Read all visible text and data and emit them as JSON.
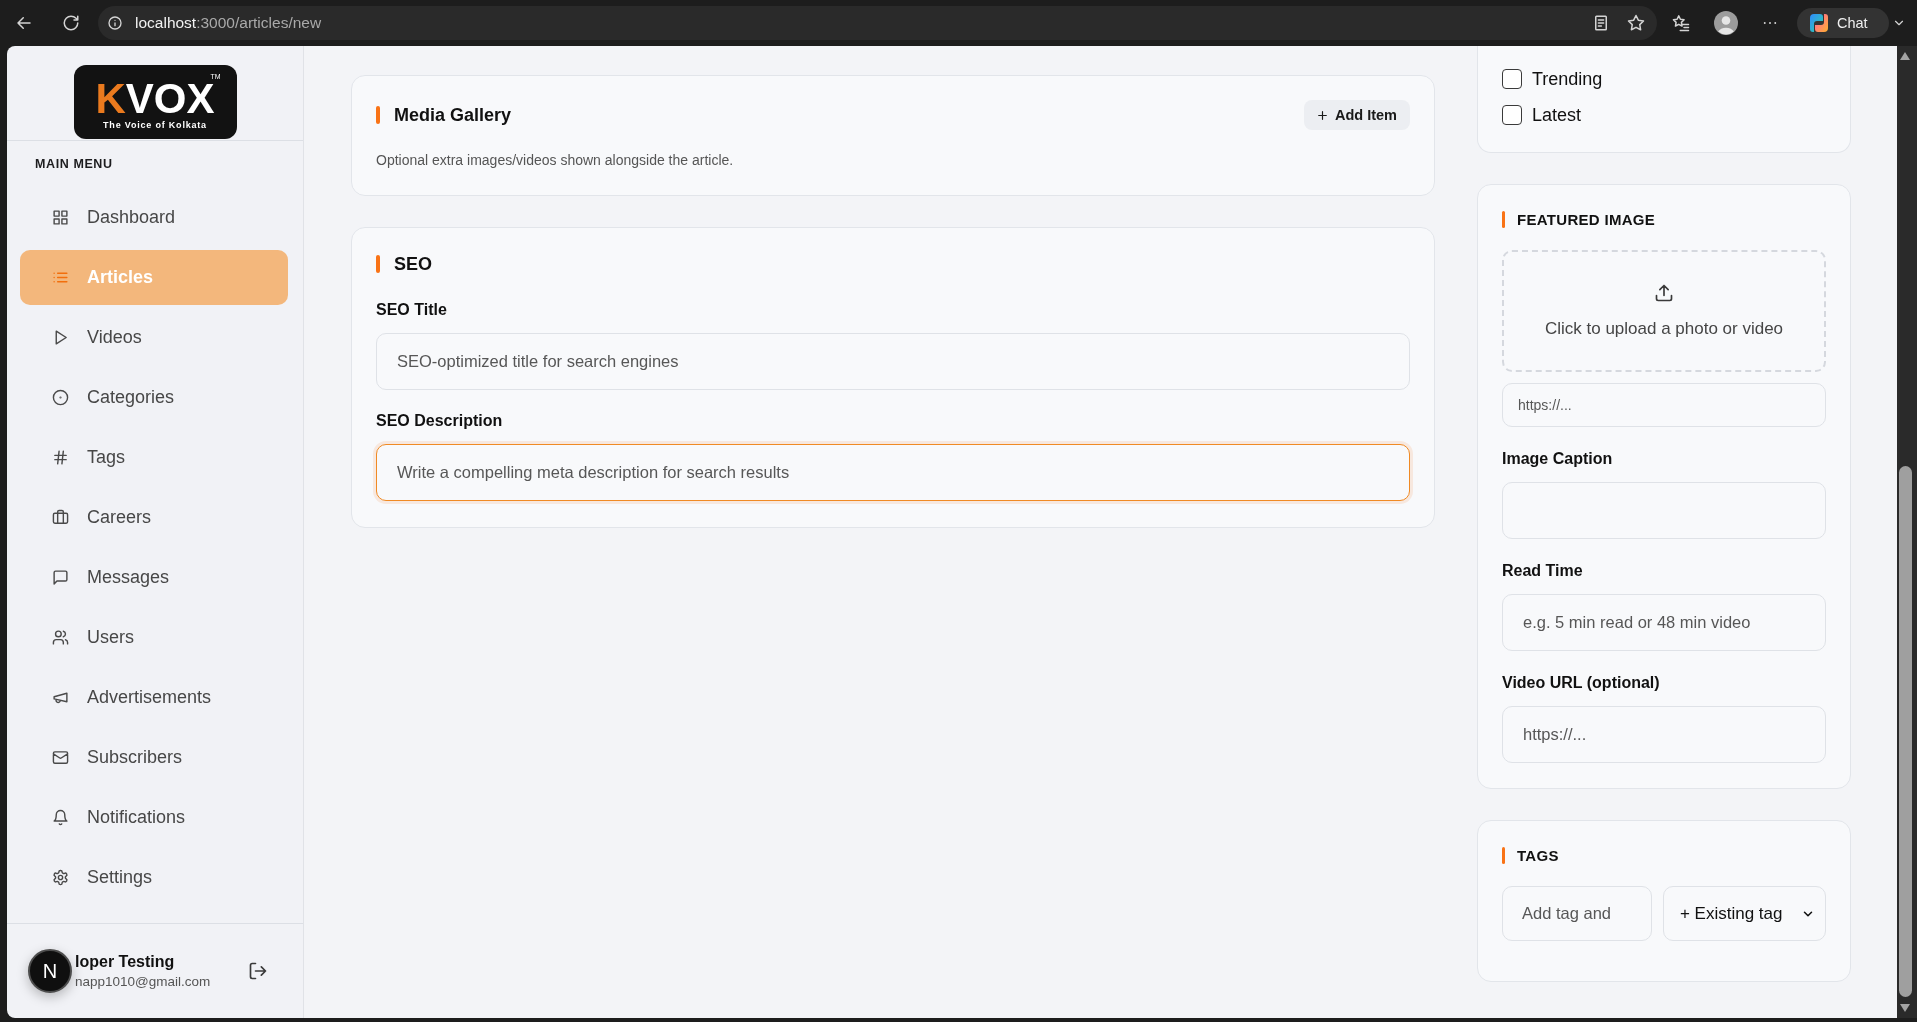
{
  "browser": {
    "url": "localhost:3000/articles/new",
    "chat_label": "Chat"
  },
  "sidebar": {
    "logo": {
      "wordmark": "KVOX",
      "trademark": "TM",
      "tagline": "The Voice of Kolkata"
    },
    "section_title": "MAIN MENU",
    "items": [
      {
        "label": "Dashboard",
        "selected": false
      },
      {
        "label": "Articles",
        "selected": true
      },
      {
        "label": "Videos",
        "selected": false
      },
      {
        "label": "Categories",
        "selected": false
      },
      {
        "label": "Tags",
        "selected": false
      },
      {
        "label": "Careers",
        "selected": false
      },
      {
        "label": "Messages",
        "selected": false
      },
      {
        "label": "Users",
        "selected": false
      },
      {
        "label": "Advertisements",
        "selected": false
      },
      {
        "label": "Subscribers",
        "selected": false
      },
      {
        "label": "Notifications",
        "selected": false
      },
      {
        "label": "Settings",
        "selected": false
      }
    ],
    "user": {
      "name": "loper Testing",
      "email": "napp1010@gmail.com"
    }
  },
  "dev_badge": {
    "label": "N"
  },
  "media_gallery": {
    "title": "Media Gallery",
    "add_button": "Add Item",
    "description": "Optional extra images/videos shown alongside the article."
  },
  "seo": {
    "title": "SEO",
    "fields": [
      {
        "label": "SEO Title",
        "placeholder": "SEO-optimized title for search engines",
        "focused": false
      },
      {
        "label": "SEO Description",
        "placeholder": "Write a compelling meta description for search results",
        "focused": true
      }
    ]
  },
  "flags": [
    {
      "label": "Trending",
      "checked": false
    },
    {
      "label": "Latest",
      "checked": false
    }
  ],
  "featured_image": {
    "title": "FEATURED IMAGE",
    "upload_text": "Click to upload a photo or video",
    "url_placeholder": "https://...",
    "fields": [
      {
        "label": "Image Caption"
      },
      {
        "label": "Read Time",
        "placeholder": "e.g. 5 min read or 48 min video"
      },
      {
        "label": "Video URL (optional)",
        "placeholder": "https://..."
      }
    ]
  },
  "tags": {
    "title": "TAGS",
    "input_placeholder": "Add tag and",
    "select_label": "+ Existing tag"
  }
}
